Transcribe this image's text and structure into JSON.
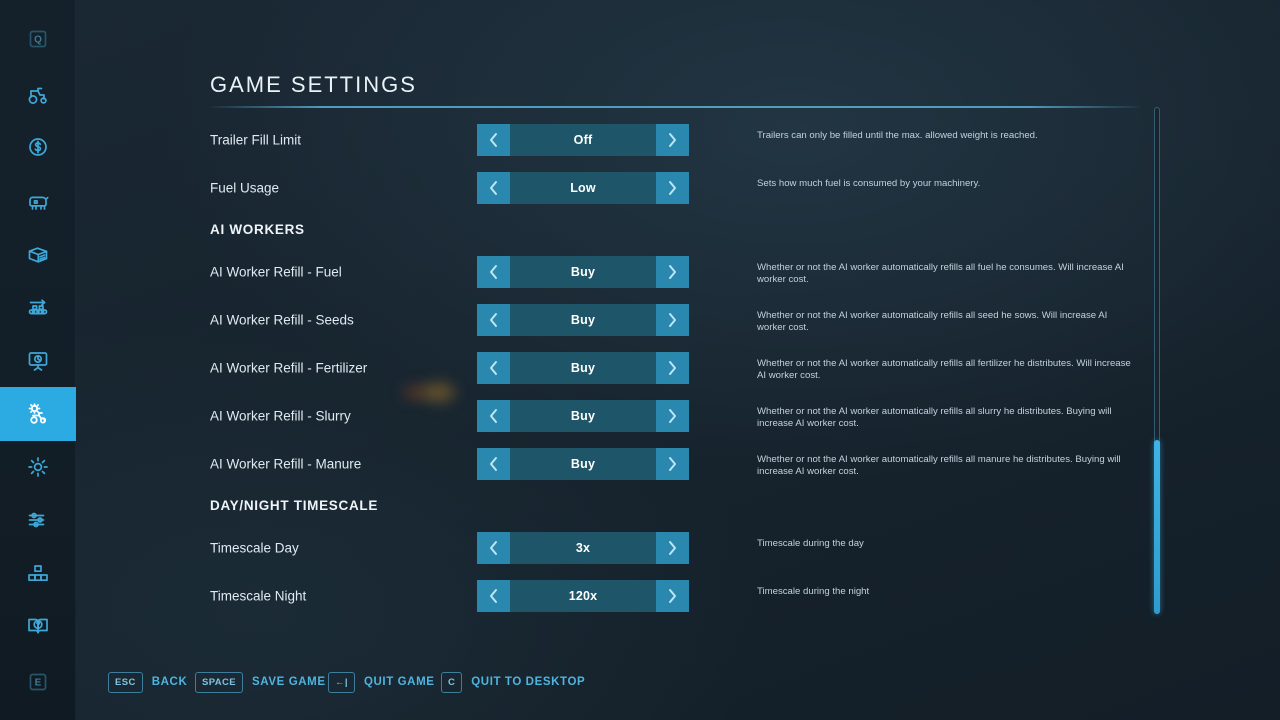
{
  "header": {
    "title": "GAME SETTINGS"
  },
  "sidebar": {
    "accent_color": "#2cabe3",
    "items": [
      {
        "name": "quick-key-q",
        "icon": "key-q-icon",
        "label": "Q",
        "active": false,
        "dim": true
      },
      {
        "name": "vehicles",
        "icon": "tractor-icon",
        "active": false
      },
      {
        "name": "finances",
        "icon": "dollar-coin-icon",
        "active": false
      },
      {
        "name": "animals",
        "icon": "cow-icon",
        "active": false
      },
      {
        "name": "contracts",
        "icon": "documents-icon",
        "active": false
      },
      {
        "name": "production",
        "icon": "conveyor-belt-icon",
        "active": false
      },
      {
        "name": "statistics",
        "icon": "presentation-board-icon",
        "active": false
      },
      {
        "name": "game-settings",
        "icon": "gear-vehicle-icon",
        "active": true
      },
      {
        "name": "general-settings",
        "icon": "gear-icon",
        "active": false
      },
      {
        "name": "controls-settings",
        "icon": "sliders-icon",
        "active": false
      },
      {
        "name": "mods",
        "icon": "grid-blocks-icon",
        "active": false
      },
      {
        "name": "help",
        "icon": "book-question-icon",
        "active": false
      },
      {
        "name": "quick-key-e",
        "icon": "key-e-icon",
        "label": "E",
        "active": false,
        "dim": true
      }
    ]
  },
  "settings": {
    "arrow_left_icon": "chevron-left-icon",
    "arrow_right_icon": "chevron-right-icon",
    "rows": [
      {
        "type": "setting",
        "label": "Trailer Fill Limit",
        "value": "Off",
        "description": "Trailers can only be filled until the max. allowed weight is reached."
      },
      {
        "type": "setting",
        "label": "Fuel Usage",
        "value": "Low",
        "description": "Sets how much fuel is consumed by your machinery."
      },
      {
        "type": "section",
        "label": "AI WORKERS"
      },
      {
        "type": "setting",
        "label": "AI Worker Refill - Fuel",
        "value": "Buy",
        "description": "Whether or not the AI worker automatically refills all fuel he consumes. Will increase AI worker cost."
      },
      {
        "type": "setting",
        "label": "AI Worker Refill - Seeds",
        "value": "Buy",
        "description": "Whether or not the AI worker automatically refills all seed he sows. Will increase AI worker cost."
      },
      {
        "type": "setting",
        "label": "AI Worker Refill - Fertilizer",
        "value": "Buy",
        "description": "Whether or not the AI worker automatically refills all fertilizer he distributes. Will increase AI worker cost."
      },
      {
        "type": "setting",
        "label": "AI Worker Refill - Slurry",
        "value": "Buy",
        "description": "Whether or not the AI worker automatically refills all slurry he distributes. Buying will increase AI worker cost."
      },
      {
        "type": "setting",
        "label": "AI Worker Refill - Manure",
        "value": "Buy",
        "description": "Whether or not the AI worker automatically refills all manure he distributes. Buying will increase AI worker cost."
      },
      {
        "type": "section",
        "label": "DAY/NIGHT TIMESCALE"
      },
      {
        "type": "setting",
        "label": "Timescale Day",
        "value": "3x",
        "description": "Timescale during the day"
      },
      {
        "type": "setting",
        "label": "Timescale Night",
        "value": "120x",
        "description": "Timescale during the night"
      }
    ]
  },
  "footer": {
    "hints": [
      {
        "key": "ESC",
        "label": "BACK",
        "icon": "keycap-esc"
      },
      {
        "key": "SPACE",
        "label": "SAVE GAME",
        "icon": "keycap-space"
      },
      {
        "key": "←|",
        "label": "QUIT GAME",
        "icon": "keycap-backspace"
      },
      {
        "key": "C",
        "label": "QUIT TO DESKTOP",
        "icon": "keycap-c"
      }
    ]
  }
}
